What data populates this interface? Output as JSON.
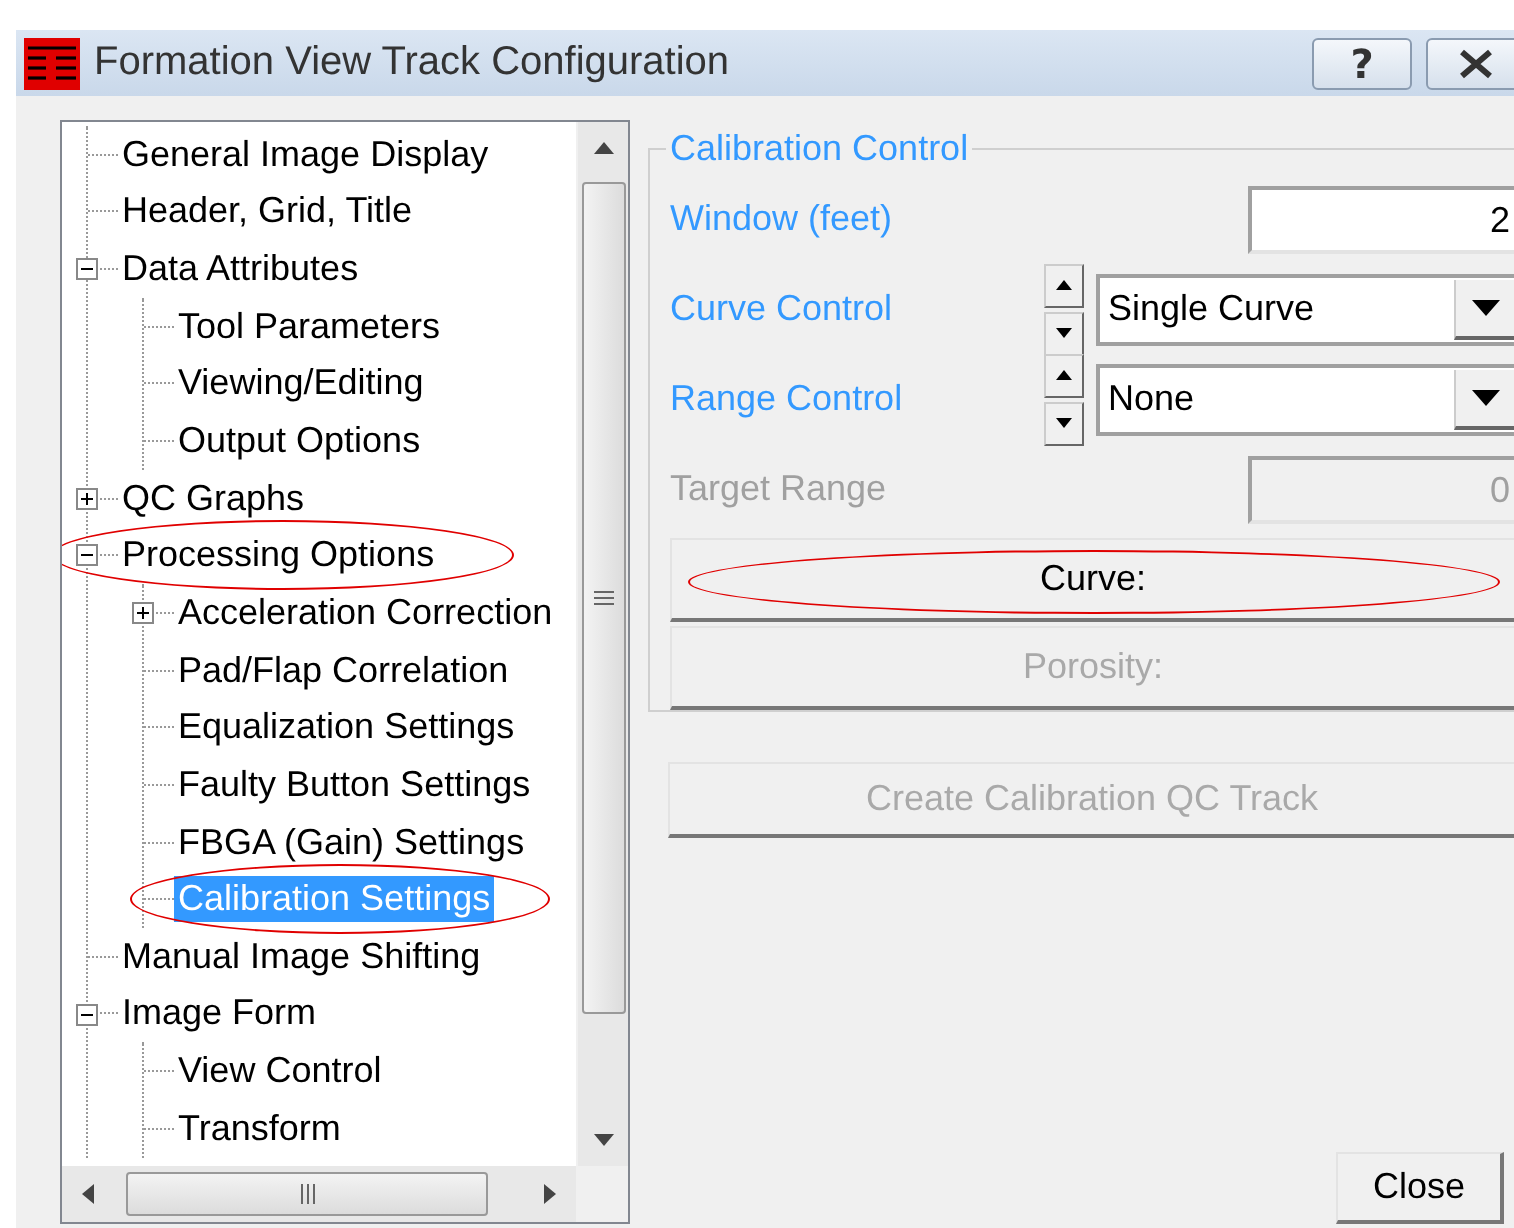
{
  "window": {
    "title": "Formation View Track Configuration",
    "help_button": "?"
  },
  "tree": {
    "items": [
      {
        "label": "General Image Display",
        "selected": false,
        "circled": false
      },
      {
        "label": "Header, Grid, Title",
        "selected": false,
        "circled": false
      },
      {
        "label": "Data Attributes",
        "selected": false,
        "circled": false,
        "expanded": true,
        "children": [
          {
            "label": "Tool Parameters",
            "selected": false,
            "circled": false
          },
          {
            "label": "Viewing/Editing",
            "selected": false,
            "circled": false
          },
          {
            "label": "Output Options",
            "selected": false,
            "circled": false
          }
        ]
      },
      {
        "label": "QC Graphs",
        "selected": false,
        "circled": false,
        "expanded": false
      },
      {
        "label": "Processing Options",
        "selected": false,
        "circled": true,
        "expanded": true,
        "children": [
          {
            "label": "Acceleration Correction",
            "selected": false,
            "circled": false,
            "expanded": false
          },
          {
            "label": "Pad/Flap Correlation",
            "selected": false,
            "circled": false
          },
          {
            "label": "Equalization Settings",
            "selected": false,
            "circled": false
          },
          {
            "label": "Faulty Button Settings",
            "selected": false,
            "circled": false
          },
          {
            "label": "FBGA (Gain) Settings",
            "selected": false,
            "circled": false
          },
          {
            "label": "Calibration Settings",
            "selected": true,
            "circled": true
          }
        ]
      },
      {
        "label": "Manual Image Shifting",
        "selected": false,
        "circled": false
      },
      {
        "label": "Image Form",
        "selected": false,
        "circled": false,
        "expanded": true,
        "children": [
          {
            "label": "View Control",
            "selected": false,
            "circled": false
          },
          {
            "label": "Transform",
            "selected": false,
            "circled": false
          }
        ]
      }
    ]
  },
  "calibration_control": {
    "title": "Calibration Control",
    "fields": [
      {
        "kind": "input",
        "label": "Window (feet)",
        "value": "2",
        "disabled": false
      },
      {
        "kind": "combo",
        "label": "Curve Control",
        "value": "Single Curve",
        "disabled": false
      },
      {
        "kind": "combo",
        "label": "Range Control",
        "value": "None",
        "disabled": false
      },
      {
        "kind": "input",
        "label": "Target Range",
        "value": "0",
        "disabled": true
      }
    ],
    "buttons": [
      {
        "label": "Curve:",
        "disabled": false,
        "circled": true
      },
      {
        "label": "Porosity:",
        "disabled": true,
        "circled": false
      }
    ]
  },
  "create_button": {
    "label": "Create Calibration QC Track",
    "disabled": true
  },
  "close_button": {
    "label": "Close"
  }
}
